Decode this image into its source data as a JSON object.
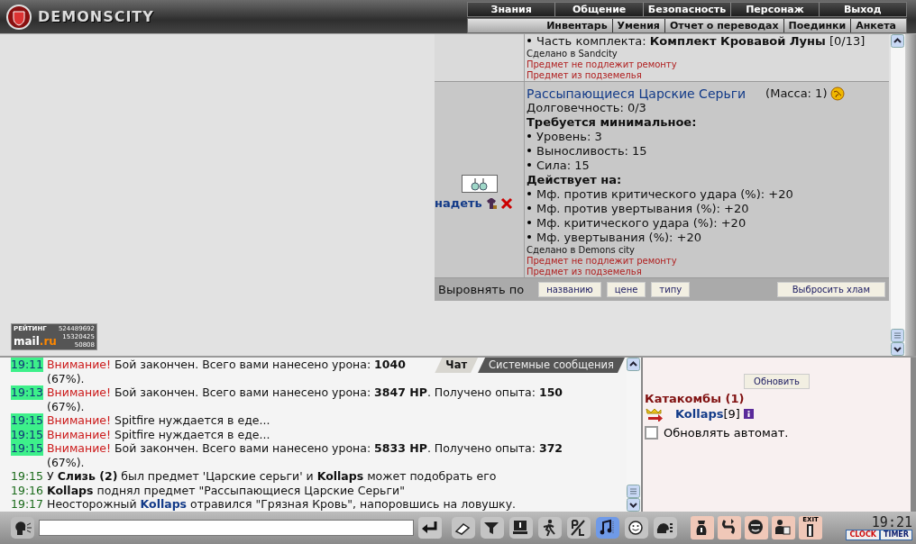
{
  "header": {
    "logo": "DEMONSCITY",
    "menu": [
      {
        "label": "Знания"
      },
      {
        "label": "Общение"
      },
      {
        "label": "Безопасность"
      },
      {
        "label": "Персонаж"
      },
      {
        "label": "Выход"
      }
    ],
    "submenu": [
      {
        "label": "Инвентарь"
      },
      {
        "label": "Умения"
      },
      {
        "label": "Отчет о переводах"
      },
      {
        "label": "Поединки"
      },
      {
        "label": "Анкета"
      }
    ]
  },
  "inventory": {
    "items": [
      {
        "lines": [
          {
            "kind": "bullet",
            "text": "Часть комплекта: **Комплект Кровавой Луны** [0/13]"
          },
          {
            "kind": "made",
            "text": "Сделано в Sandcity"
          },
          {
            "kind": "warning",
            "text": "Предмет не подлежит ремонту"
          },
          {
            "kind": "warning",
            "text": "Предмет из подземелья"
          }
        ]
      },
      {
        "title": "Рассыпающиеся Царские Серьги",
        "mass": "(Масса: 1)",
        "action": "надеть",
        "lines": [
          {
            "kind": "text",
            "text": "Долговечность: 0/3"
          },
          {
            "kind": "heading",
            "text": "Требуется минимальное:"
          },
          {
            "kind": "bullet",
            "text": "Уровень: 3"
          },
          {
            "kind": "bullet",
            "text": "Выносливость: 15"
          },
          {
            "kind": "bullet",
            "text": "Сила: 15"
          },
          {
            "kind": "heading",
            "text": "Действует на:"
          },
          {
            "kind": "bullet",
            "text": "Мф. против критического удара (%): +20"
          },
          {
            "kind": "bullet",
            "text": "Мф. против увертывания (%): +20"
          },
          {
            "kind": "bullet",
            "text": "Мф. критического удара (%): +20"
          },
          {
            "kind": "bullet",
            "text": "Мф. увертывания (%): +20"
          },
          {
            "kind": "made",
            "text": "Сделано в Demons city"
          },
          {
            "kind": "warning",
            "text": "Предмет не подлежит ремонту"
          },
          {
            "kind": "warning",
            "text": "Предмет из подземелья"
          }
        ]
      }
    ],
    "sort": {
      "label": "Выровнять по",
      "buttons": [
        "названию",
        "цене",
        "типу"
      ]
    },
    "discard_button": "Выбросить хлам"
  },
  "counter": {
    "title": "РЕЙТИНГ",
    "total": "524489692",
    "logo_main": "mail",
    "logo_accent": ".ru",
    "hits": "15320425",
    "hosts": "50808"
  },
  "chat": {
    "tabs": [
      {
        "label": "Чат",
        "selected": true
      },
      {
        "label": "Системные сообщения",
        "selected": false
      }
    ],
    "messages": [
      {
        "time": "19:11",
        "highlight": true,
        "parts": [
          {
            "kind": "alert",
            "text": "Внимание!"
          },
          {
            "kind": "plain",
            "text": "Бой закончен. Всего вами нанесено урона: **1040**"
          },
          {
            "kind": "wrap",
            "text": "(67%)."
          }
        ]
      },
      {
        "time": "19:13",
        "highlight": true,
        "parts": [
          {
            "kind": "alert",
            "text": "Внимание!"
          },
          {
            "kind": "plain",
            "text": "Бой закончен. Всего вами нанесено урона: **3847 HP**. Получено опыта: **150**"
          },
          {
            "kind": "wrap",
            "text": "(67%)."
          }
        ]
      },
      {
        "time": "19:15",
        "highlight": true,
        "parts": [
          {
            "kind": "alert",
            "text": "Внимание!"
          },
          {
            "kind": "plain",
            "text": "Spitfire нуждается в еде..."
          }
        ]
      },
      {
        "time": "19:15",
        "highlight": true,
        "parts": [
          {
            "kind": "alert",
            "text": "Внимание!"
          },
          {
            "kind": "plain",
            "text": "Spitfire нуждается в еде..."
          }
        ]
      },
      {
        "time": "19:15",
        "highlight": true,
        "parts": [
          {
            "kind": "alert",
            "text": "Внимание!"
          },
          {
            "kind": "plain",
            "text": "Бой закончен. Всего вами нанесено урона: **5833 HP**. Получено опыта: **372**"
          },
          {
            "kind": "wrap",
            "text": "(67%)."
          }
        ]
      },
      {
        "time": "19:15",
        "highlight": false,
        "parts": [
          {
            "kind": "plain",
            "text": "У **Слизь (2)** был предмет 'Царские серьги' и **Kollaps** может подобрать его"
          }
        ]
      },
      {
        "time": "19:16",
        "highlight": false,
        "parts": [
          {
            "kind": "plain",
            "text": "**Kollaps** поднял предмет \"Рассыпающиеся Царские Серьги\""
          }
        ]
      },
      {
        "time": "19:17",
        "highlight": false,
        "parts": [
          {
            "kind": "plain",
            "text": "Неосторожный"
          },
          {
            "kind": "nick",
            "text": "Kollaps"
          },
          {
            "kind": "plain",
            "text": "отравился \"Грязная Кровь\", напоровшись на ловушку."
          }
        ]
      }
    ]
  },
  "online": {
    "refresh_button": "Обновить",
    "location": "Катакомбы (1)",
    "players": [
      {
        "name": "Kollaps",
        "level": "[9]"
      }
    ],
    "auto_refresh": {
      "label": "Обновлять автомат.",
      "checked": false
    }
  },
  "toolbar": {
    "tools": [
      {
        "kind": "eraser",
        "selected": false
      },
      {
        "kind": "filter",
        "selected": false
      },
      {
        "kind": "monitor",
        "selected": false
      },
      {
        "kind": "walker",
        "selected": false
      },
      {
        "kind": "pl",
        "selected": false
      },
      {
        "kind": "music",
        "selected": true
      },
      {
        "kind": "smiley",
        "selected": false
      },
      {
        "kind": "helmet",
        "selected": false
      }
    ],
    "panel_buttons": [
      {
        "kind": "bag"
      },
      {
        "kind": "swap"
      },
      {
        "kind": "face"
      },
      {
        "kind": "people"
      },
      {
        "kind": "exit",
        "label": "EXIT"
      }
    ],
    "clock": {
      "time": "19:21",
      "clock_label": "CLOCK",
      "timer_label": "TIMER"
    }
  }
}
